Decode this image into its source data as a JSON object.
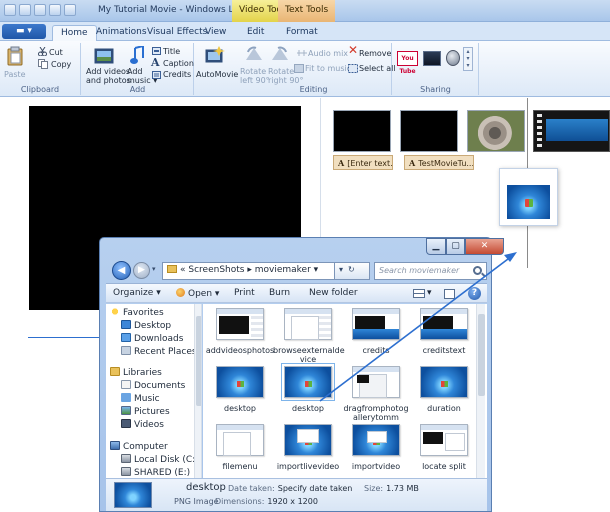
{
  "window": {
    "title": "My Tutorial Movie - Windows Live Movie...",
    "context_video": "Video Tools",
    "context_text": "Text Tools"
  },
  "tabs": [
    "Home",
    "Animations",
    "Visual Effects",
    "View",
    "Edit",
    "Format"
  ],
  "ribbon": {
    "clipboard": {
      "paste": "Paste",
      "cut": "Cut",
      "copy": "Copy",
      "label": "Clipboard"
    },
    "add": {
      "add_videos_1": "Add videos",
      "add_videos_2": "and photos",
      "add_music_1": "Add",
      "add_music_2": "music",
      "title": "Title",
      "caption": "Caption",
      "credits": "Credits",
      "label": "Add"
    },
    "automovie": "AutoMovie",
    "editing": {
      "rotate_left_1": "Rotate",
      "rotate_left_2": "left 90°",
      "rotate_right_1": "Rotate",
      "rotate_right_2": "right 90°",
      "audio_mix": "Audio mix",
      "fit_music": "Fit to music",
      "remove": "Remove",
      "select_all": "Select all",
      "label": "Editing"
    },
    "sharing": {
      "label": "Sharing",
      "youtube": "You Tube"
    }
  },
  "storyboard": {
    "caption1": "[Enter text...",
    "caption2": "TestMovieTu..."
  },
  "explorer": {
    "path": [
      "ScreenShots",
      "moviemaker"
    ],
    "search_placeholder": "Search moviemaker",
    "commands": {
      "organize": "Organize",
      "open": "Open",
      "print": "Print",
      "burn": "Burn",
      "new_folder": "New folder"
    },
    "nav": {
      "favorites": "Favorites",
      "desktop": "Desktop",
      "downloads": "Downloads",
      "recent": "Recent Places",
      "libraries": "Libraries",
      "documents": "Documents",
      "music": "Music",
      "pictures": "Pictures",
      "videos": "Videos",
      "computer": "Computer",
      "local_disk": "Local Disk (C:)",
      "shared": "SHARED (E:)"
    },
    "files": [
      {
        "name": "addvideosphotos"
      },
      {
        "name": "browseexternalde vice"
      },
      {
        "name": "credits"
      },
      {
        "name": "creditstext"
      },
      {
        "name": "desktop"
      },
      {
        "name": "desktop"
      },
      {
        "name": "dragfromphotog allerytomm"
      },
      {
        "name": "duration"
      },
      {
        "name": "filemenu"
      },
      {
        "name": "importlivevideo"
      },
      {
        "name": "importvideo"
      },
      {
        "name": "locate split"
      }
    ],
    "details": {
      "name": "desktop",
      "type": "PNG Image",
      "date_label": "Date taken:",
      "date_value": "Specify date taken",
      "dim_label": "Dimensions:",
      "dim_value": "1920 x 1200",
      "size_label": "Size:",
      "size_value": "1.73 MB"
    }
  },
  "colors": {
    "accent": "#2d6fcf",
    "ribbon_bg": "#dde9f7",
    "video_tools": "#e3d34a",
    "text_tools": "#e9b574"
  }
}
